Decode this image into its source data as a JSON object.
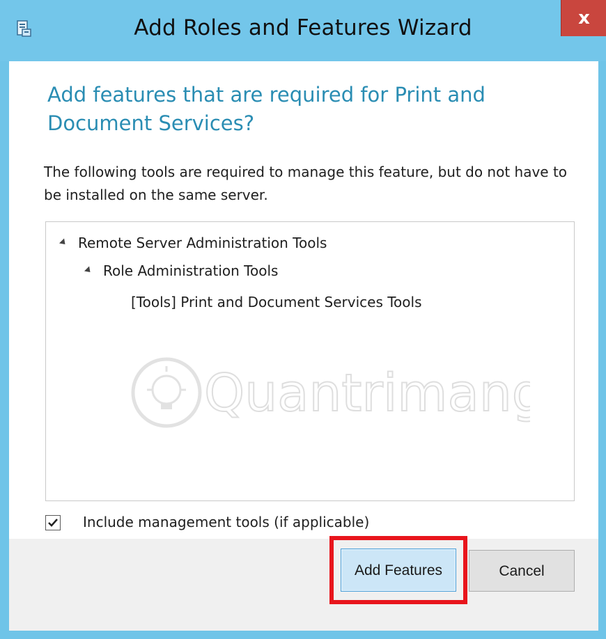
{
  "window": {
    "title": "Add Roles and Features Wizard",
    "close_label": "x"
  },
  "heading": "Add features that are required for Print and Document Services?",
  "description": "The following tools are required to manage this feature, but do not have to be installed on the same server.",
  "tree": {
    "items": [
      {
        "label": "Remote Server Administration Tools",
        "level": 0,
        "expanded": true
      },
      {
        "label": "Role Administration Tools",
        "level": 1,
        "expanded": true
      },
      {
        "label": "[Tools] Print and Document Services Tools",
        "level": 2,
        "expanded": false
      }
    ]
  },
  "watermark": {
    "text": "Quantrimang"
  },
  "include_tools": {
    "label": "Include management tools (if applicable)",
    "checked": true
  },
  "buttons": {
    "add_features": "Add Features",
    "cancel": "Cancel"
  },
  "colors": {
    "titlebar": "#73c6ea",
    "heading": "#2a8db3",
    "close": "#c9463e",
    "highlight": "#e8151c"
  }
}
